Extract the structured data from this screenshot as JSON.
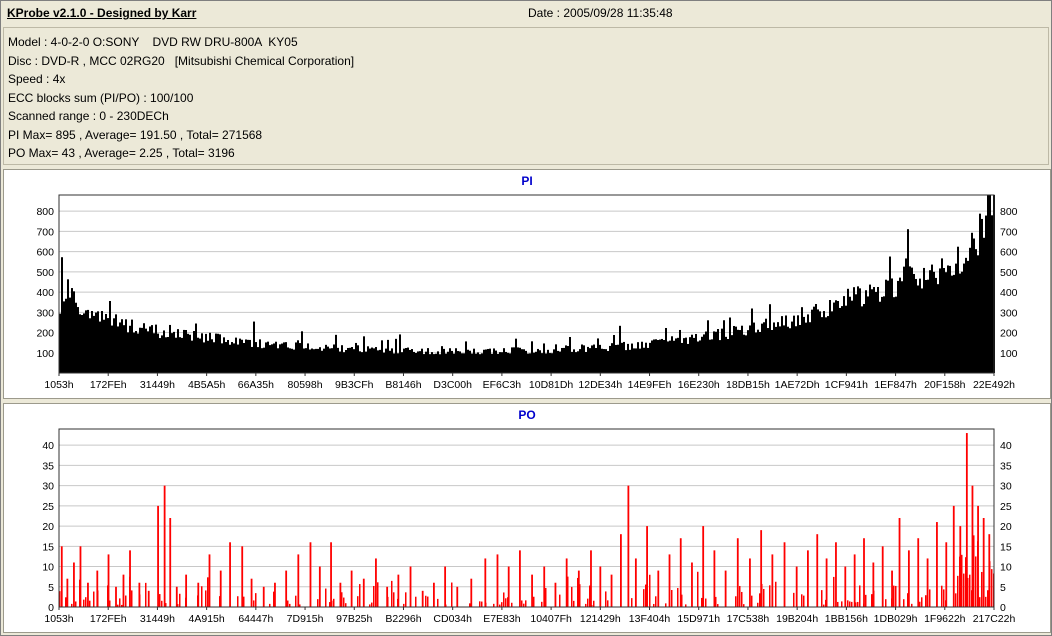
{
  "header": {
    "app_title": "KProbe v2.1.0 - Designed by Karr",
    "date_label": "Date : 2005/09/28 11:35:48"
  },
  "info": {
    "model": "Model : 4-0-2-0 O:SONY    DVD RW DRU-800A  KY05",
    "disc": "Disc : DVD-R , MCC 02RG20   [Mitsubishi Chemical Corporation]",
    "speed": "Speed : 4x",
    "ecc": "ECC blocks sum (PI/PO) : 100/100",
    "scanned_range": "Scanned range : 0 - 230DECh",
    "pi_stats": "PI Max= 895 , Average= 191.50 , Total= 271568",
    "po_stats": "PO Max= 43 , Average= 2.25 , Total= 3196"
  },
  "colors": {
    "background": "#ECE9D8",
    "chart_title": "#0000CC",
    "grid": "#C8C8C8",
    "plot_border": "#303030",
    "pi_bar": "#000000",
    "po_bar": "#FF0000"
  },
  "chart_data": [
    {
      "type": "bar",
      "title": "PI",
      "xlabel": "",
      "ylabel": "",
      "ylim": [
        0,
        880
      ],
      "yticks": [
        100,
        200,
        300,
        400,
        500,
        600,
        700,
        800
      ],
      "x_tick_labels": [
        "1053h",
        "172FEh",
        "31449h",
        "4B5A5h",
        "66A35h",
        "80598h",
        "9B3CFh",
        "B8146h",
        "D3C00h",
        "EF6C3h",
        "10D81Dh",
        "12DE34h",
        "14E9FEh",
        "16E230h",
        "18DB15h",
        "1AE72Dh",
        "1CF941h",
        "1EF847h",
        "20F158h",
        "22E492h"
      ],
      "stats": {
        "max": 895,
        "average": 191.5,
        "total": 271568
      },
      "bar_color": "#000000",
      "grid_on": true,
      "legend": "none",
      "envelope": [
        [
          0,
          340
        ],
        [
          0.006,
          420
        ],
        [
          0.02,
          310
        ],
        [
          0.04,
          275
        ],
        [
          0.07,
          240
        ],
        [
          0.1,
          210
        ],
        [
          0.13,
          190
        ],
        [
          0.16,
          172
        ],
        [
          0.19,
          158
        ],
        [
          0.22,
          142
        ],
        [
          0.25,
          132
        ],
        [
          0.28,
          124
        ],
        [
          0.32,
          118
        ],
        [
          0.36,
          113
        ],
        [
          0.4,
          110
        ],
        [
          0.44,
          110
        ],
        [
          0.48,
          112
        ],
        [
          0.52,
          115
        ],
        [
          0.56,
          122
        ],
        [
          0.6,
          132
        ],
        [
          0.63,
          145
        ],
        [
          0.66,
          160
        ],
        [
          0.69,
          178
        ],
        [
          0.72,
          200
        ],
        [
          0.75,
          228
        ],
        [
          0.78,
          262
        ],
        [
          0.81,
          305
        ],
        [
          0.84,
          355
        ],
        [
          0.87,
          400
        ],
        [
          0.895,
          430
        ],
        [
          0.902,
          440
        ],
        [
          0.907,
          615
        ],
        [
          0.912,
          450
        ],
        [
          0.925,
          455
        ],
        [
          0.94,
          490
        ],
        [
          0.955,
          525
        ],
        [
          0.966,
          565
        ],
        [
          0.975,
          610
        ],
        [
          0.984,
          680
        ],
        [
          0.991,
          780
        ],
        [
          0.996,
          850
        ],
        [
          1,
          880
        ]
      ],
      "noise": 0.16,
      "spike_chance": 0.05,
      "spike_factor": 1.35
    },
    {
      "type": "bar",
      "title": "PO",
      "xlabel": "",
      "ylabel": "",
      "ylim": [
        0,
        44
      ],
      "yticks": [
        0,
        5,
        10,
        15,
        20,
        25,
        30,
        35,
        40
      ],
      "x_tick_labels": [
        "1053h",
        "172FEh",
        "31449h",
        "4A915h",
        "64447h",
        "7D915h",
        "97B25h",
        "B2296h",
        "CD034h",
        "E7E83h",
        "10407Fh",
        "121429h",
        "13F404h",
        "15D971h",
        "17C538h",
        "19B204h",
        "1BB156h",
        "1DB029h",
        "1F9622h",
        "217C22h"
      ],
      "stats": {
        "max": 43,
        "average": 2.25,
        "total": 3196
      },
      "bar_color": "#FF0000",
      "grid_on": true,
      "legend": "none",
      "background_density": 0.5,
      "background_max": 9,
      "end_cluster": {
        "from": 0.955,
        "max": 18
      },
      "spikes": [
        [
          0.002,
          15
        ],
        [
          0.008,
          7
        ],
        [
          0.015,
          11
        ],
        [
          0.022,
          15
        ],
        [
          0.03,
          6
        ],
        [
          0.04,
          9
        ],
        [
          0.052,
          13
        ],
        [
          0.06,
          5
        ],
        [
          0.068,
          8
        ],
        [
          0.075,
          14
        ],
        [
          0.085,
          6
        ],
        [
          0.095,
          4
        ],
        [
          0.105,
          25
        ],
        [
          0.112,
          30
        ],
        [
          0.118,
          22
        ],
        [
          0.125,
          5
        ],
        [
          0.135,
          8
        ],
        [
          0.148,
          6
        ],
        [
          0.16,
          13
        ],
        [
          0.172,
          9
        ],
        [
          0.182,
          16
        ],
        [
          0.195,
          15
        ],
        [
          0.205,
          7
        ],
        [
          0.218,
          5
        ],
        [
          0.23,
          6
        ],
        [
          0.242,
          9
        ],
        [
          0.255,
          13
        ],
        [
          0.268,
          16
        ],
        [
          0.278,
          10
        ],
        [
          0.29,
          16
        ],
        [
          0.3,
          6
        ],
        [
          0.312,
          9
        ],
        [
          0.325,
          7
        ],
        [
          0.338,
          12
        ],
        [
          0.35,
          5
        ],
        [
          0.362,
          8
        ],
        [
          0.375,
          10
        ],
        [
          0.388,
          4
        ],
        [
          0.4,
          6
        ],
        [
          0.412,
          10
        ],
        [
          0.425,
          5
        ],
        [
          0.44,
          7
        ],
        [
          0.455,
          12
        ],
        [
          0.468,
          13
        ],
        [
          0.48,
          10
        ],
        [
          0.492,
          14
        ],
        [
          0.505,
          8
        ],
        [
          0.518,
          10
        ],
        [
          0.53,
          6
        ],
        [
          0.542,
          12
        ],
        [
          0.555,
          9
        ],
        [
          0.568,
          14
        ],
        [
          0.578,
          10
        ],
        [
          0.59,
          8
        ],
        [
          0.6,
          18
        ],
        [
          0.608,
          30
        ],
        [
          0.616,
          12
        ],
        [
          0.628,
          20
        ],
        [
          0.64,
          9
        ],
        [
          0.652,
          13
        ],
        [
          0.664,
          17
        ],
        [
          0.676,
          11
        ],
        [
          0.688,
          20
        ],
        [
          0.7,
          14
        ],
        [
          0.712,
          9
        ],
        [
          0.725,
          17
        ],
        [
          0.738,
          12
        ],
        [
          0.75,
          19
        ],
        [
          0.762,
          13
        ],
        [
          0.775,
          16
        ],
        [
          0.788,
          10
        ],
        [
          0.8,
          14
        ],
        [
          0.81,
          18
        ],
        [
          0.82,
          12
        ],
        [
          0.83,
          16
        ],
        [
          0.84,
          10
        ],
        [
          0.85,
          13
        ],
        [
          0.86,
          17
        ],
        [
          0.87,
          11
        ],
        [
          0.88,
          15
        ],
        [
          0.89,
          9
        ],
        [
          0.898,
          22
        ],
        [
          0.908,
          14
        ],
        [
          0.918,
          17
        ],
        [
          0.928,
          12
        ],
        [
          0.938,
          21
        ],
        [
          0.948,
          16
        ],
        [
          0.956,
          25
        ],
        [
          0.963,
          20
        ],
        [
          0.97,
          43
        ],
        [
          0.976,
          30
        ],
        [
          0.982,
          25
        ],
        [
          0.988,
          22
        ],
        [
          0.994,
          18
        ]
      ]
    }
  ]
}
